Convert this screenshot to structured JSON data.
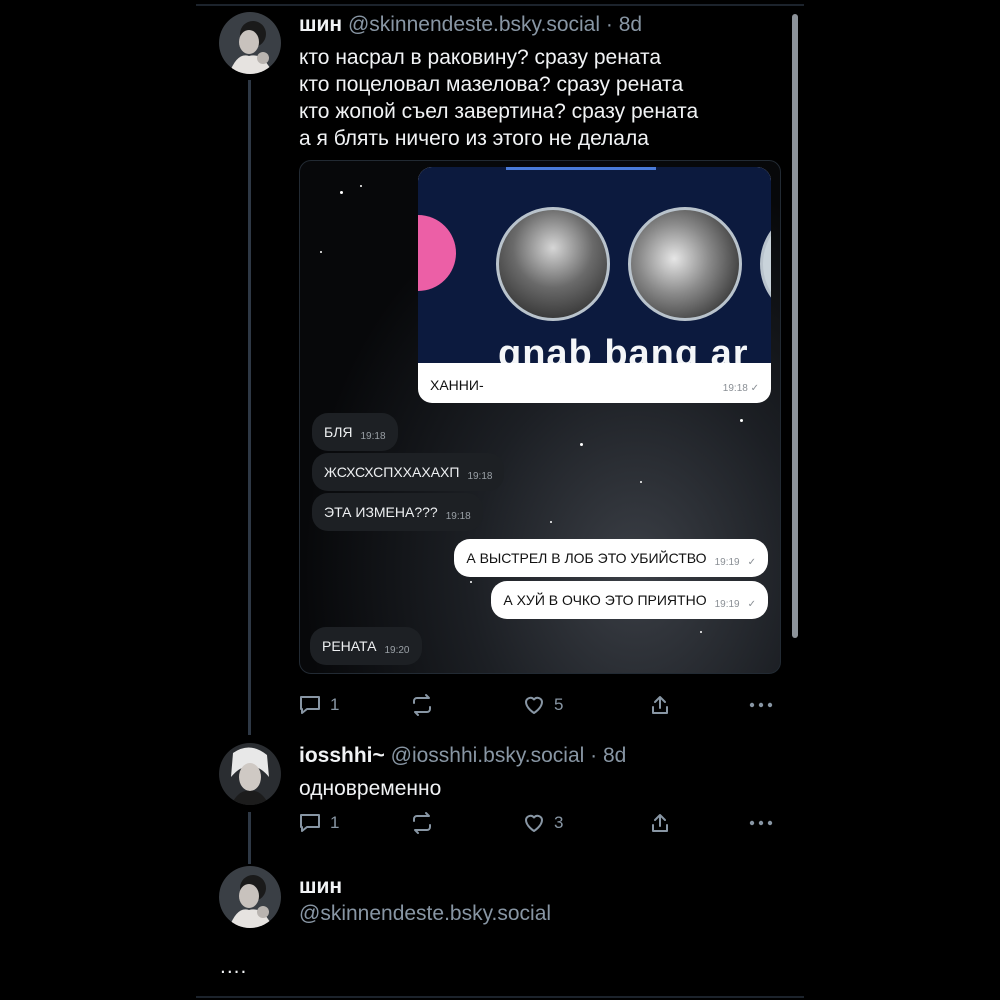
{
  "posts": [
    {
      "name": "шин",
      "handle": "@skinnendeste.bsky.social",
      "dot": "·",
      "time": "8d",
      "lines": [
        "кто насрал в раковину? сразу рената",
        "кто поцеловал мазелова? сразу рената",
        "кто жопой съел завертина? сразу рената",
        "а я блять ничего из этого не делала"
      ],
      "reply_count": "1",
      "like_count": "5",
      "media": {
        "story_overlay_text": "qnab bang ar",
        "story_caption": "ХАННИ-",
        "story_time": "19:18",
        "messages": [
          {
            "text": "БЛЯ",
            "time": "19:18",
            "dir": "in"
          },
          {
            "text": "ЖСХСХСПХХАХАХП",
            "time": "19:18",
            "dir": "in"
          },
          {
            "text": "ЭТА ИЗМЕНА???",
            "time": "19:18",
            "dir": "in"
          },
          {
            "text": "А ВЫСТРЕЛ В ЛОБ ЭТО УБИЙСТВО",
            "time": "19:19",
            "dir": "out"
          },
          {
            "text": "А ХУЙ В ОЧКО ЭТО ПРИЯТНО",
            "time": "19:19",
            "dir": "out"
          },
          {
            "text": "РЕНАТА",
            "time": "19:20",
            "dir": "in"
          }
        ]
      }
    },
    {
      "name": "iosshhi~",
      "handle": "@iosshhi.bsky.social",
      "dot": "·",
      "time": "8d",
      "text": "одновременно",
      "reply_count": "1",
      "like_count": "3"
    },
    {
      "name": "шин",
      "handle": "@skinnendeste.bsky.social",
      "text": "...."
    }
  ],
  "icons": {
    "reply": "reply-bubble-icon",
    "repost": "repost-icon",
    "like": "heart-icon",
    "share": "share-icon",
    "more": "more-icon",
    "read": "double-check-icon"
  },
  "colors": {
    "background": "#000000",
    "text": "#f1f3f5",
    "muted": "#8896a4",
    "thread_line": "#2e3845",
    "like_pink": "#ec5fa6"
  }
}
